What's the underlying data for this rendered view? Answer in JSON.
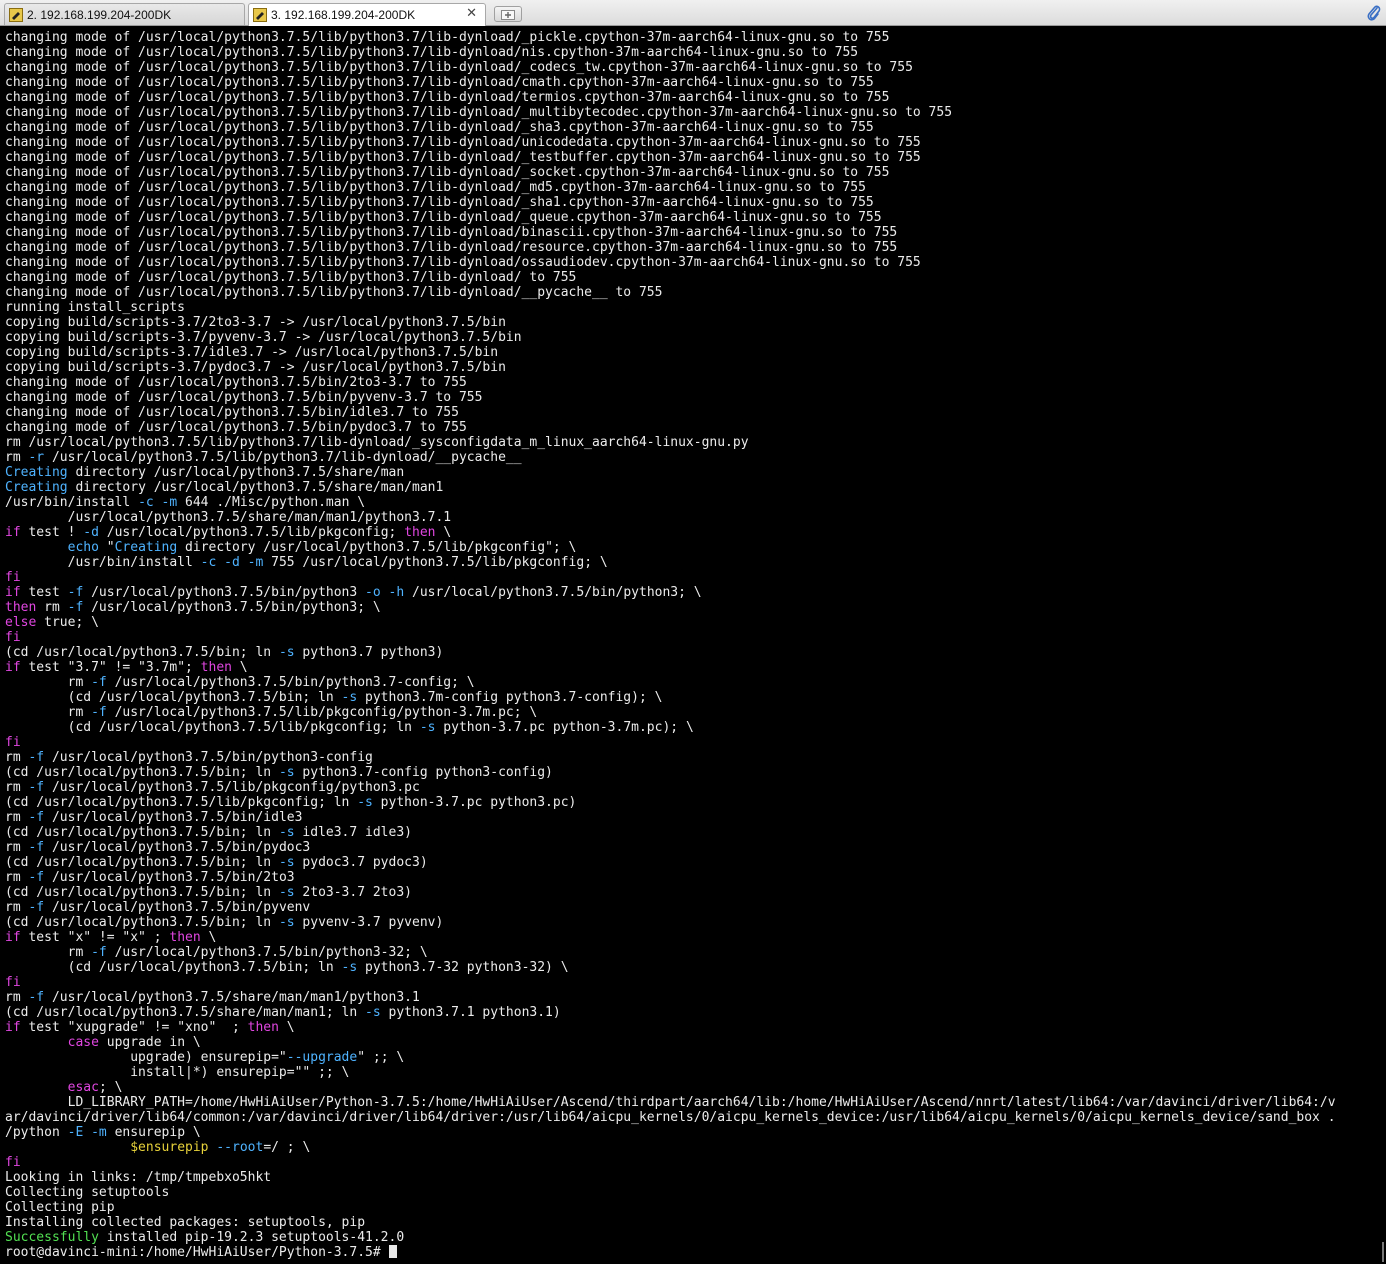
{
  "tabs": [
    {
      "label": "2. 192.168.199.204-200DK",
      "active": false
    },
    {
      "label": "3. 192.168.199.204-200DK",
      "active": true
    }
  ],
  "colors": {
    "background": "#000000",
    "text": "#ececec",
    "keyword": "#e046e0",
    "option": "#4fb3ff",
    "success": "#52e052",
    "variable": "#e6d13a"
  },
  "terminal": {
    "lines": [
      [
        {
          "t": "changing mode of /usr/local/python3.7.5/lib/python3.7/lib-dynload/_pickle.cpython-37m-aarch64-linux-gnu.so to 755"
        }
      ],
      [
        {
          "t": "changing mode of /usr/local/python3.7.5/lib/python3.7/lib-dynload/nis.cpython-37m-aarch64-linux-gnu.so to 755"
        }
      ],
      [
        {
          "t": "changing mode of /usr/local/python3.7.5/lib/python3.7/lib-dynload/_codecs_tw.cpython-37m-aarch64-linux-gnu.so to 755"
        }
      ],
      [
        {
          "t": "changing mode of /usr/local/python3.7.5/lib/python3.7/lib-dynload/cmath.cpython-37m-aarch64-linux-gnu.so to 755"
        }
      ],
      [
        {
          "t": "changing mode of /usr/local/python3.7.5/lib/python3.7/lib-dynload/termios.cpython-37m-aarch64-linux-gnu.so to 755"
        }
      ],
      [
        {
          "t": "changing mode of /usr/local/python3.7.5/lib/python3.7/lib-dynload/_multibytecodec.cpython-37m-aarch64-linux-gnu.so to 755"
        }
      ],
      [
        {
          "t": "changing mode of /usr/local/python3.7.5/lib/python3.7/lib-dynload/_sha3.cpython-37m-aarch64-linux-gnu.so to 755"
        }
      ],
      [
        {
          "t": "changing mode of /usr/local/python3.7.5/lib/python3.7/lib-dynload/unicodedata.cpython-37m-aarch64-linux-gnu.so to 755"
        }
      ],
      [
        {
          "t": "changing mode of /usr/local/python3.7.5/lib/python3.7/lib-dynload/_testbuffer.cpython-37m-aarch64-linux-gnu.so to 755"
        }
      ],
      [
        {
          "t": "changing mode of /usr/local/python3.7.5/lib/python3.7/lib-dynload/_socket.cpython-37m-aarch64-linux-gnu.so to 755"
        }
      ],
      [
        {
          "t": "changing mode of /usr/local/python3.7.5/lib/python3.7/lib-dynload/_md5.cpython-37m-aarch64-linux-gnu.so to 755"
        }
      ],
      [
        {
          "t": "changing mode of /usr/local/python3.7.5/lib/python3.7/lib-dynload/_sha1.cpython-37m-aarch64-linux-gnu.so to 755"
        }
      ],
      [
        {
          "t": "changing mode of /usr/local/python3.7.5/lib/python3.7/lib-dynload/_queue.cpython-37m-aarch64-linux-gnu.so to 755"
        }
      ],
      [
        {
          "t": "changing mode of /usr/local/python3.7.5/lib/python3.7/lib-dynload/binascii.cpython-37m-aarch64-linux-gnu.so to 755"
        }
      ],
      [
        {
          "t": "changing mode of /usr/local/python3.7.5/lib/python3.7/lib-dynload/resource.cpython-37m-aarch64-linux-gnu.so to 755"
        }
      ],
      [
        {
          "t": "changing mode of /usr/local/python3.7.5/lib/python3.7/lib-dynload/ossaudiodev.cpython-37m-aarch64-linux-gnu.so to 755"
        }
      ],
      [
        {
          "t": "changing mode of /usr/local/python3.7.5/lib/python3.7/lib-dynload/ to 755"
        }
      ],
      [
        {
          "t": "changing mode of /usr/local/python3.7.5/lib/python3.7/lib-dynload/__pycache__ to 755"
        }
      ],
      [
        {
          "t": "running install_scripts"
        }
      ],
      [
        {
          "t": "copying build/scripts-3.7/2to3-3.7 -> /usr/local/python3.7.5/bin"
        }
      ],
      [
        {
          "t": "copying build/scripts-3.7/pyvenv-3.7 -> /usr/local/python3.7.5/bin"
        }
      ],
      [
        {
          "t": "copying build/scripts-3.7/idle3.7 -> /usr/local/python3.7.5/bin"
        }
      ],
      [
        {
          "t": "copying build/scripts-3.7/pydoc3.7 -> /usr/local/python3.7.5/bin"
        }
      ],
      [
        {
          "t": "changing mode of /usr/local/python3.7.5/bin/2to3-3.7 to 755"
        }
      ],
      [
        {
          "t": "changing mode of /usr/local/python3.7.5/bin/pyvenv-3.7 to 755"
        }
      ],
      [
        {
          "t": "changing mode of /usr/local/python3.7.5/bin/idle3.7 to 755"
        }
      ],
      [
        {
          "t": "changing mode of /usr/local/python3.7.5/bin/pydoc3.7 to 755"
        }
      ],
      [
        {
          "t": "rm /usr/local/python3.7.5/lib/python3.7/lib-dynload/_sysconfigdata_m_linux_aarch64-linux-gnu.py"
        }
      ],
      [
        {
          "t": "rm "
        },
        {
          "t": "-r",
          "c": "cyan"
        },
        {
          "t": " /usr/local/python3.7.5/lib/python3.7/lib-dynload/__pycache__"
        }
      ],
      [
        {
          "t": "Creating",
          "c": "cyan"
        },
        {
          "t": " directory /usr/local/python3.7.5/share/man"
        }
      ],
      [
        {
          "t": "Creating",
          "c": "cyan"
        },
        {
          "t": " directory /usr/local/python3.7.5/share/man/man1"
        }
      ],
      [
        {
          "t": "/usr/bin/install "
        },
        {
          "t": "-c",
          "c": "cyan"
        },
        {
          "t": " "
        },
        {
          "t": "-m",
          "c": "cyan"
        },
        {
          "t": " 644 ./Misc/python.man \\"
        }
      ],
      [
        {
          "t": "        /usr/local/python3.7.5/share/man/man1/python3.7.1"
        }
      ],
      [
        {
          "t": "if",
          "c": "mag"
        },
        {
          "t": " test ! "
        },
        {
          "t": "-d",
          "c": "cyan"
        },
        {
          "t": " /usr/local/python3.7.5/lib/pkgconfig; "
        },
        {
          "t": "then",
          "c": "mag"
        },
        {
          "t": " \\"
        }
      ],
      [
        {
          "t": "        "
        },
        {
          "t": "echo",
          "c": "cyan"
        },
        {
          "t": " \""
        },
        {
          "t": "Creating",
          "c": "cyan"
        },
        {
          "t": " directory /usr/local/python3.7.5/lib/pkgconfig\"; \\"
        }
      ],
      [
        {
          "t": "        /usr/bin/install "
        },
        {
          "t": "-c",
          "c": "cyan"
        },
        {
          "t": " "
        },
        {
          "t": "-d",
          "c": "cyan"
        },
        {
          "t": " "
        },
        {
          "t": "-m",
          "c": "cyan"
        },
        {
          "t": " 755 /usr/local/python3.7.5/lib/pkgconfig; \\"
        }
      ],
      [
        {
          "t": "fi",
          "c": "mag"
        }
      ],
      [
        {
          "t": "if",
          "c": "mag"
        },
        {
          "t": " test "
        },
        {
          "t": "-f",
          "c": "cyan"
        },
        {
          "t": " /usr/local/python3.7.5/bin/python3 "
        },
        {
          "t": "-o",
          "c": "cyan"
        },
        {
          "t": " "
        },
        {
          "t": "-h",
          "c": "cyan"
        },
        {
          "t": " /usr/local/python3.7.5/bin/python3; \\"
        }
      ],
      [
        {
          "t": "then",
          "c": "mag"
        },
        {
          "t": " rm "
        },
        {
          "t": "-f",
          "c": "cyan"
        },
        {
          "t": " /usr/local/python3.7.5/bin/python3; \\"
        }
      ],
      [
        {
          "t": "else",
          "c": "mag"
        },
        {
          "t": " true; \\"
        }
      ],
      [
        {
          "t": "fi",
          "c": "mag"
        }
      ],
      [
        {
          "t": "(cd /usr/local/python3.7.5/bin; ln "
        },
        {
          "t": "-s",
          "c": "cyan"
        },
        {
          "t": " python3.7 python3)"
        }
      ],
      [
        {
          "t": "if",
          "c": "mag"
        },
        {
          "t": " test \"3.7\" != \"3.7m\"; "
        },
        {
          "t": "then",
          "c": "mag"
        },
        {
          "t": " \\"
        }
      ],
      [
        {
          "t": "        rm "
        },
        {
          "t": "-f",
          "c": "cyan"
        },
        {
          "t": " /usr/local/python3.7.5/bin/python3.7-config; \\"
        }
      ],
      [
        {
          "t": "        (cd /usr/local/python3.7.5/bin; ln "
        },
        {
          "t": "-s",
          "c": "cyan"
        },
        {
          "t": " python3.7m-config python3.7-config); \\"
        }
      ],
      [
        {
          "t": "        rm "
        },
        {
          "t": "-f",
          "c": "cyan"
        },
        {
          "t": " /usr/local/python3.7.5/lib/pkgconfig/python-3.7m.pc; \\"
        }
      ],
      [
        {
          "t": "        (cd /usr/local/python3.7.5/lib/pkgconfig; ln "
        },
        {
          "t": "-s",
          "c": "cyan"
        },
        {
          "t": " python-3.7.pc python-3.7m.pc); \\"
        }
      ],
      [
        {
          "t": "fi",
          "c": "mag"
        }
      ],
      [
        {
          "t": "rm "
        },
        {
          "t": "-f",
          "c": "cyan"
        },
        {
          "t": " /usr/local/python3.7.5/bin/python3-config"
        }
      ],
      [
        {
          "t": "(cd /usr/local/python3.7.5/bin; ln "
        },
        {
          "t": "-s",
          "c": "cyan"
        },
        {
          "t": " python3.7-config python3-config)"
        }
      ],
      [
        {
          "t": "rm "
        },
        {
          "t": "-f",
          "c": "cyan"
        },
        {
          "t": " /usr/local/python3.7.5/lib/pkgconfig/python3.pc"
        }
      ],
      [
        {
          "t": "(cd /usr/local/python3.7.5/lib/pkgconfig; ln "
        },
        {
          "t": "-s",
          "c": "cyan"
        },
        {
          "t": " python-3.7.pc python3.pc)"
        }
      ],
      [
        {
          "t": "rm "
        },
        {
          "t": "-f",
          "c": "cyan"
        },
        {
          "t": " /usr/local/python3.7.5/bin/idle3"
        }
      ],
      [
        {
          "t": "(cd /usr/local/python3.7.5/bin; ln "
        },
        {
          "t": "-s",
          "c": "cyan"
        },
        {
          "t": " idle3.7 idle3)"
        }
      ],
      [
        {
          "t": "rm "
        },
        {
          "t": "-f",
          "c": "cyan"
        },
        {
          "t": " /usr/local/python3.7.5/bin/pydoc3"
        }
      ],
      [
        {
          "t": "(cd /usr/local/python3.7.5/bin; ln "
        },
        {
          "t": "-s",
          "c": "cyan"
        },
        {
          "t": " pydoc3.7 pydoc3)"
        }
      ],
      [
        {
          "t": "rm "
        },
        {
          "t": "-f",
          "c": "cyan"
        },
        {
          "t": " /usr/local/python3.7.5/bin/2to3"
        }
      ],
      [
        {
          "t": "(cd /usr/local/python3.7.5/bin; ln "
        },
        {
          "t": "-s",
          "c": "cyan"
        },
        {
          "t": " 2to3-3.7 2to3)"
        }
      ],
      [
        {
          "t": "rm "
        },
        {
          "t": "-f",
          "c": "cyan"
        },
        {
          "t": " /usr/local/python3.7.5/bin/pyvenv"
        }
      ],
      [
        {
          "t": "(cd /usr/local/python3.7.5/bin; ln "
        },
        {
          "t": "-s",
          "c": "cyan"
        },
        {
          "t": " pyvenv-3.7 pyvenv)"
        }
      ],
      [
        {
          "t": "if",
          "c": "mag"
        },
        {
          "t": " test \"x\" != \"x\" ; "
        },
        {
          "t": "then",
          "c": "mag"
        },
        {
          "t": " \\"
        }
      ],
      [
        {
          "t": "        rm "
        },
        {
          "t": "-f",
          "c": "cyan"
        },
        {
          "t": " /usr/local/python3.7.5/bin/python3-32; \\"
        }
      ],
      [
        {
          "t": "        (cd /usr/local/python3.7.5/bin; ln "
        },
        {
          "t": "-s",
          "c": "cyan"
        },
        {
          "t": " python3.7-32 python3-32) \\"
        }
      ],
      [
        {
          "t": "fi",
          "c": "mag"
        }
      ],
      [
        {
          "t": "rm "
        },
        {
          "t": "-f",
          "c": "cyan"
        },
        {
          "t": " /usr/local/python3.7.5/share/man/man1/python3.1"
        }
      ],
      [
        {
          "t": "(cd /usr/local/python3.7.5/share/man/man1; ln "
        },
        {
          "t": "-s",
          "c": "cyan"
        },
        {
          "t": " python3.7.1 python3.1)"
        }
      ],
      [
        {
          "t": "if",
          "c": "mag"
        },
        {
          "t": " test \"xupgrade\" != \"xno\"  ; "
        },
        {
          "t": "then",
          "c": "mag"
        },
        {
          "t": " \\"
        }
      ],
      [
        {
          "t": "        "
        },
        {
          "t": "case",
          "c": "mag"
        },
        {
          "t": " upgrade in \\"
        }
      ],
      [
        {
          "t": "                upgrade) ensurepip=\""
        },
        {
          "t": "--upgrade",
          "c": "cyan"
        },
        {
          "t": "\" ;; \\"
        }
      ],
      [
        {
          "t": "                install|*) ensurepip=\"\" ;; \\"
        }
      ],
      [
        {
          "t": "        "
        },
        {
          "t": "esac",
          "c": "mag"
        },
        {
          "t": "; \\"
        }
      ],
      [
        {
          "t": "        LD_LIBRARY_PATH=/home/HwHiAiUser/Python-3.7.5:/home/HwHiAiUser/Ascend/thirdpart/aarch64/lib:/home/HwHiAiUser/Ascend/nnrt/latest/lib64:/var/davinci/driver/lib64:/v"
        }
      ],
      [
        {
          "t": "ar/davinci/driver/lib64/common:/var/davinci/driver/lib64/driver:/usr/lib64/aicpu_kernels/0/aicpu_kernels_device:/usr/lib64/aicpu_kernels/0/aicpu_kernels_device/sand_box ."
        }
      ],
      [
        {
          "t": "/python "
        },
        {
          "t": "-E",
          "c": "cyan"
        },
        {
          "t": " "
        },
        {
          "t": "-m",
          "c": "cyan"
        },
        {
          "t": " ensurepip \\"
        }
      ],
      [
        {
          "t": "                "
        },
        {
          "t": "$ensurepip",
          "c": "yel"
        },
        {
          "t": " "
        },
        {
          "t": "--root",
          "c": "cyan"
        },
        {
          "t": "=/ ; \\"
        }
      ],
      [
        {
          "t": "fi",
          "c": "mag"
        }
      ],
      [
        {
          "t": "Looking in links: /tmp/tmpebxo5hkt"
        }
      ],
      [
        {
          "t": "Collecting setuptools"
        }
      ],
      [
        {
          "t": "Collecting pip"
        }
      ],
      [
        {
          "t": "Installing collected packages: setuptools, pip"
        }
      ],
      [
        {
          "t": "Successfully",
          "c": "grn"
        },
        {
          "t": " installed pip-19.2.3 setuptools-41.2.0"
        }
      ],
      [
        {
          "t": "root@davinci-mini:/home/HwHiAiUser/Python-3.7.5# "
        }
      ]
    ]
  }
}
